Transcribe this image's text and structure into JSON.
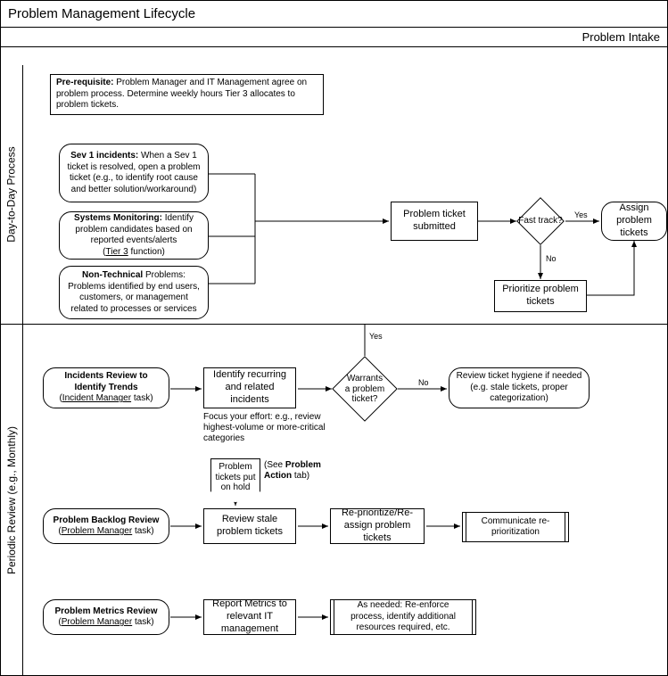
{
  "title": "Problem Management Lifecycle",
  "subtitle": "Problem Intake",
  "lanes": {
    "lane1": "Day-to-Day Process",
    "lane2": "Periodic Review (e.g., Monthly)"
  },
  "lane1": {
    "prereq_bold": "Pre-requisite:",
    "prereq_text": " Problem Manager and IT Management agree on problem process. Determine weekly hours Tier 3 allocates to problem tickets.",
    "sev1_bold": "Sev 1 incidents:",
    "sev1_text": " When a Sev 1 ticket is resolved, open a problem ticket (e.g., to identify root cause and better solution/workaround)",
    "sysmon_bold": "Systems Monitoring:",
    "sysmon_text1": " Identify problem candidates based on reported events/alerts",
    "sysmon_text2_pre": "(",
    "sysmon_tier3": "Tier 3",
    "sysmon_text2_post": " function)",
    "nontech_bold": "Non-Technical",
    "nontech_text": " Problems: Problems identified by end users, customers, or management related to processes or services",
    "submitted": "Problem ticket submitted",
    "fasttrack": "Fast track?",
    "assign": "Assign problem tickets",
    "prioritize": "Prioritize problem tickets",
    "yes": "Yes",
    "no": "No"
  },
  "lane2": {
    "incidents_bold": "Incidents Review to Identify Trends",
    "incidents_role_pre": "(",
    "incidents_role": "Incident Manager",
    "incidents_role_post": " task)",
    "identify": "Identify recurring and related incidents",
    "identify_note": "Focus your effort: e.g., review highest-volume or more-critical categories",
    "warrants": "Warrants\na problem\nticket?",
    "hygiene": "Review ticket hygiene if needed (e.g. stale tickets, proper categorization)",
    "yes": "Yes",
    "no": "No",
    "onhold": "Problem tickets put on hold",
    "onhold_note_pre": "(See ",
    "onhold_note_bold": "Problem Action",
    "onhold_note_post": " tab)",
    "backlog_bold": "Problem Backlog Review",
    "backlog_role_pre": "(",
    "backlog_role": "Problem Manager",
    "backlog_role_post": " task)",
    "review_stale": "Review stale problem tickets",
    "reprioritize": "Re-prioritize/Re-assign problem tickets",
    "communicate": "Communicate re-prioritization",
    "metrics_bold": "Problem Metrics Review",
    "metrics_role_pre": "(",
    "metrics_role": "Problem Manager",
    "metrics_role_post": " task)",
    "report": "Report Metrics to relevant IT management",
    "asneeded": "As needed: Re-enforce process, identify additional resources required, etc."
  }
}
